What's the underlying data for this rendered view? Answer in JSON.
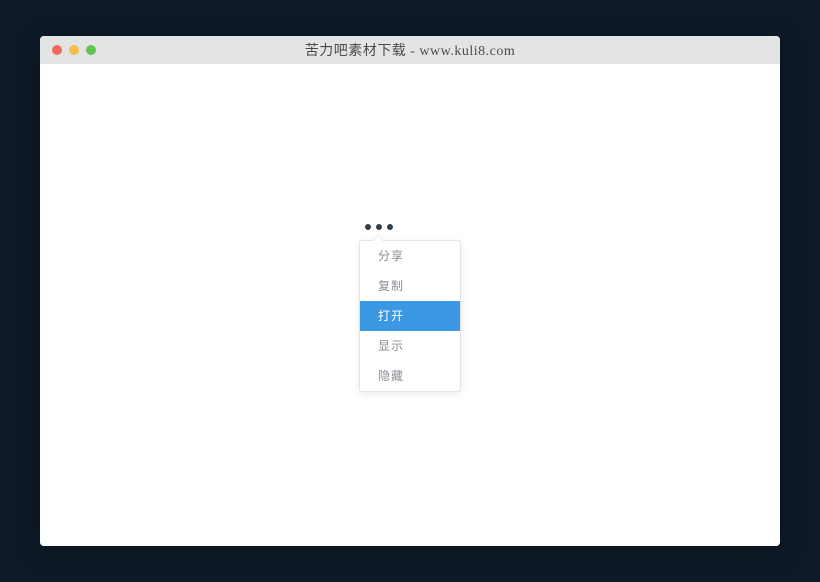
{
  "window": {
    "title": "苦力吧素材下载 - www.kuli8.com"
  },
  "menu": {
    "items": [
      {
        "label": "分享",
        "hover": false
      },
      {
        "label": "复制",
        "hover": false
      },
      {
        "label": "打开",
        "hover": true
      },
      {
        "label": "显示",
        "hover": false
      },
      {
        "label": "隐藏",
        "hover": false
      }
    ]
  }
}
